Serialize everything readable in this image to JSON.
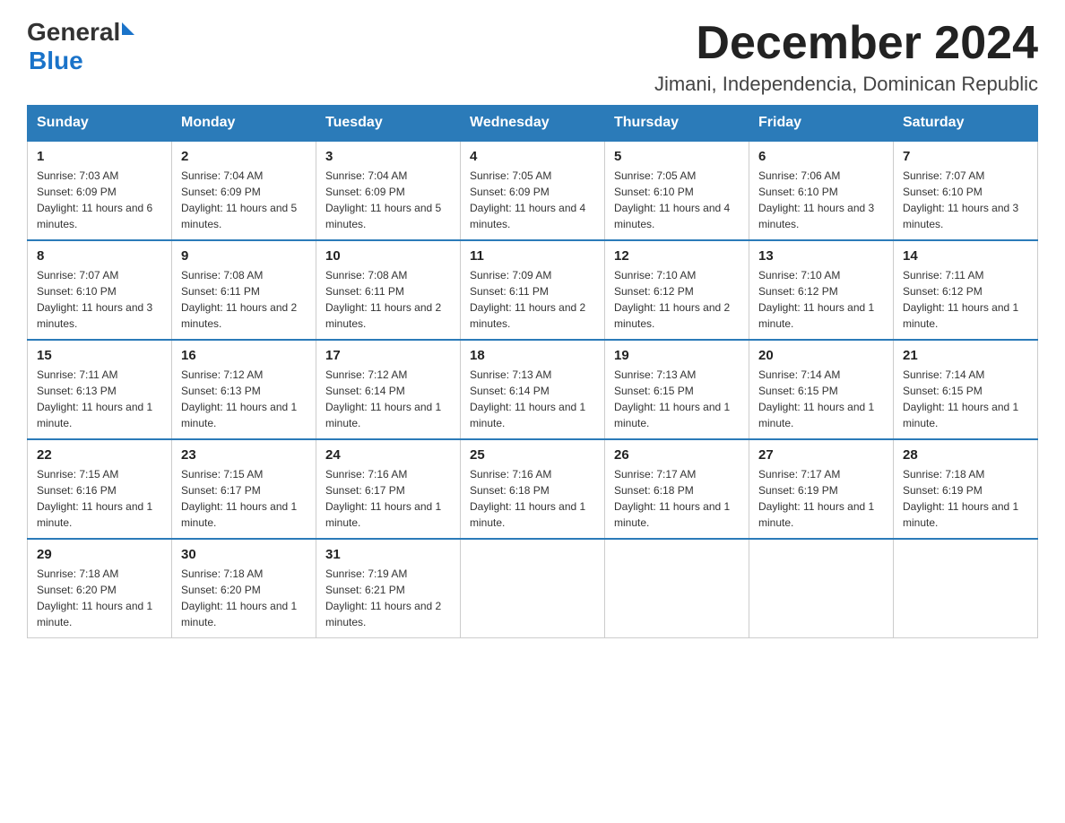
{
  "header": {
    "logo_general": "General",
    "logo_blue": "Blue",
    "month_title": "December 2024",
    "location": "Jimani, Independencia, Dominican Republic"
  },
  "days_of_week": [
    "Sunday",
    "Monday",
    "Tuesday",
    "Wednesday",
    "Thursday",
    "Friday",
    "Saturday"
  ],
  "weeks": [
    [
      {
        "day": "1",
        "sunrise": "7:03 AM",
        "sunset": "6:09 PM",
        "daylight": "11 hours and 6 minutes."
      },
      {
        "day": "2",
        "sunrise": "7:04 AM",
        "sunset": "6:09 PM",
        "daylight": "11 hours and 5 minutes."
      },
      {
        "day": "3",
        "sunrise": "7:04 AM",
        "sunset": "6:09 PM",
        "daylight": "11 hours and 5 minutes."
      },
      {
        "day": "4",
        "sunrise": "7:05 AM",
        "sunset": "6:09 PM",
        "daylight": "11 hours and 4 minutes."
      },
      {
        "day": "5",
        "sunrise": "7:05 AM",
        "sunset": "6:10 PM",
        "daylight": "11 hours and 4 minutes."
      },
      {
        "day": "6",
        "sunrise": "7:06 AM",
        "sunset": "6:10 PM",
        "daylight": "11 hours and 3 minutes."
      },
      {
        "day": "7",
        "sunrise": "7:07 AM",
        "sunset": "6:10 PM",
        "daylight": "11 hours and 3 minutes."
      }
    ],
    [
      {
        "day": "8",
        "sunrise": "7:07 AM",
        "sunset": "6:10 PM",
        "daylight": "11 hours and 3 minutes."
      },
      {
        "day": "9",
        "sunrise": "7:08 AM",
        "sunset": "6:11 PM",
        "daylight": "11 hours and 2 minutes."
      },
      {
        "day": "10",
        "sunrise": "7:08 AM",
        "sunset": "6:11 PM",
        "daylight": "11 hours and 2 minutes."
      },
      {
        "day": "11",
        "sunrise": "7:09 AM",
        "sunset": "6:11 PM",
        "daylight": "11 hours and 2 minutes."
      },
      {
        "day": "12",
        "sunrise": "7:10 AM",
        "sunset": "6:12 PM",
        "daylight": "11 hours and 2 minutes."
      },
      {
        "day": "13",
        "sunrise": "7:10 AM",
        "sunset": "6:12 PM",
        "daylight": "11 hours and 1 minute."
      },
      {
        "day": "14",
        "sunrise": "7:11 AM",
        "sunset": "6:12 PM",
        "daylight": "11 hours and 1 minute."
      }
    ],
    [
      {
        "day": "15",
        "sunrise": "7:11 AM",
        "sunset": "6:13 PM",
        "daylight": "11 hours and 1 minute."
      },
      {
        "day": "16",
        "sunrise": "7:12 AM",
        "sunset": "6:13 PM",
        "daylight": "11 hours and 1 minute."
      },
      {
        "day": "17",
        "sunrise": "7:12 AM",
        "sunset": "6:14 PM",
        "daylight": "11 hours and 1 minute."
      },
      {
        "day": "18",
        "sunrise": "7:13 AM",
        "sunset": "6:14 PM",
        "daylight": "11 hours and 1 minute."
      },
      {
        "day": "19",
        "sunrise": "7:13 AM",
        "sunset": "6:15 PM",
        "daylight": "11 hours and 1 minute."
      },
      {
        "day": "20",
        "sunrise": "7:14 AM",
        "sunset": "6:15 PM",
        "daylight": "11 hours and 1 minute."
      },
      {
        "day": "21",
        "sunrise": "7:14 AM",
        "sunset": "6:15 PM",
        "daylight": "11 hours and 1 minute."
      }
    ],
    [
      {
        "day": "22",
        "sunrise": "7:15 AM",
        "sunset": "6:16 PM",
        "daylight": "11 hours and 1 minute."
      },
      {
        "day": "23",
        "sunrise": "7:15 AM",
        "sunset": "6:17 PM",
        "daylight": "11 hours and 1 minute."
      },
      {
        "day": "24",
        "sunrise": "7:16 AM",
        "sunset": "6:17 PM",
        "daylight": "11 hours and 1 minute."
      },
      {
        "day": "25",
        "sunrise": "7:16 AM",
        "sunset": "6:18 PM",
        "daylight": "11 hours and 1 minute."
      },
      {
        "day": "26",
        "sunrise": "7:17 AM",
        "sunset": "6:18 PM",
        "daylight": "11 hours and 1 minute."
      },
      {
        "day": "27",
        "sunrise": "7:17 AM",
        "sunset": "6:19 PM",
        "daylight": "11 hours and 1 minute."
      },
      {
        "day": "28",
        "sunrise": "7:18 AM",
        "sunset": "6:19 PM",
        "daylight": "11 hours and 1 minute."
      }
    ],
    [
      {
        "day": "29",
        "sunrise": "7:18 AM",
        "sunset": "6:20 PM",
        "daylight": "11 hours and 1 minute."
      },
      {
        "day": "30",
        "sunrise": "7:18 AM",
        "sunset": "6:20 PM",
        "daylight": "11 hours and 1 minute."
      },
      {
        "day": "31",
        "sunrise": "7:19 AM",
        "sunset": "6:21 PM",
        "daylight": "11 hours and 2 minutes."
      },
      null,
      null,
      null,
      null
    ]
  ],
  "labels": {
    "sunrise": "Sunrise:",
    "sunset": "Sunset:",
    "daylight": "Daylight:"
  }
}
